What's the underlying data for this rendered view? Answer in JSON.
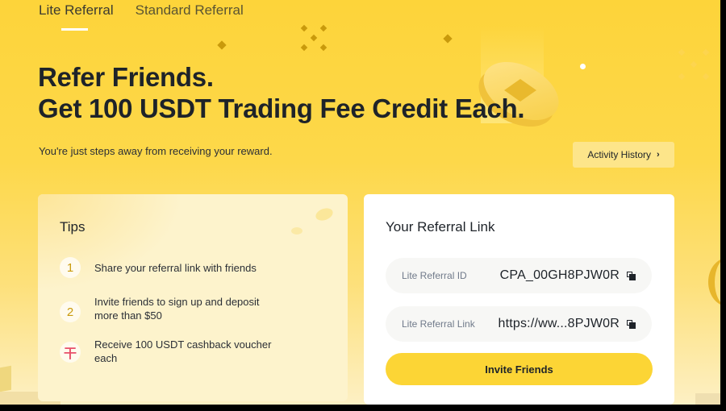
{
  "tabs": [
    {
      "label": "Lite Referral",
      "active": true
    },
    {
      "label": "Standard Referral",
      "active": false
    }
  ],
  "hero": {
    "title_line1": "Refer Friends.",
    "title_line2": "Get 100 USDT Trading Fee Credit Each.",
    "subtitle": "You're just steps away from receiving your reward.",
    "activity_history_label": "Activity History",
    "activity_history_icon": "chevron-right-icon"
  },
  "tips": {
    "title": "Tips",
    "items": [
      {
        "badge": "1",
        "text": "Share your referral link with friends"
      },
      {
        "badge": "2",
        "text": "Invite friends to sign up and deposit more than $50"
      },
      {
        "badge": "gift-icon",
        "text": "Receive 100 USDT cashback voucher each"
      }
    ]
  },
  "referral": {
    "title": "Your Referral Link",
    "id_label": "Lite Referral ID",
    "id_value": "CPA_00GH8PJW0R",
    "link_label": "Lite Referral Link",
    "link_value": "https://ww...8PJW0R",
    "copy_icon": "copy-icon",
    "invite_label": "Invite Friends"
  },
  "colors": {
    "brand_yellow": "#fcd535",
    "text_primary": "#1e2329",
    "text_secondary": "#707a8a",
    "tip_number": "#c99a0c",
    "gift": "#e8506a"
  }
}
